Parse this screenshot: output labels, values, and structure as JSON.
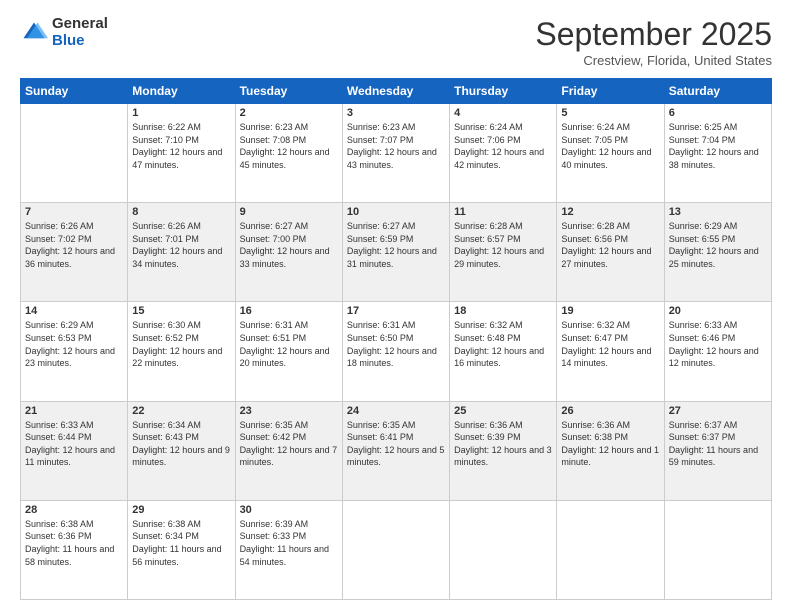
{
  "logo": {
    "general": "General",
    "blue": "Blue"
  },
  "header": {
    "month": "September 2025",
    "location": "Crestview, Florida, United States"
  },
  "weekdays": [
    "Sunday",
    "Monday",
    "Tuesday",
    "Wednesday",
    "Thursday",
    "Friday",
    "Saturday"
  ],
  "weeks": [
    [
      {
        "date": "",
        "sunrise": "",
        "sunset": "",
        "daylight": ""
      },
      {
        "date": "1",
        "sunrise": "Sunrise: 6:22 AM",
        "sunset": "Sunset: 7:10 PM",
        "daylight": "Daylight: 12 hours and 47 minutes."
      },
      {
        "date": "2",
        "sunrise": "Sunrise: 6:23 AM",
        "sunset": "Sunset: 7:08 PM",
        "daylight": "Daylight: 12 hours and 45 minutes."
      },
      {
        "date": "3",
        "sunrise": "Sunrise: 6:23 AM",
        "sunset": "Sunset: 7:07 PM",
        "daylight": "Daylight: 12 hours and 43 minutes."
      },
      {
        "date": "4",
        "sunrise": "Sunrise: 6:24 AM",
        "sunset": "Sunset: 7:06 PM",
        "daylight": "Daylight: 12 hours and 42 minutes."
      },
      {
        "date": "5",
        "sunrise": "Sunrise: 6:24 AM",
        "sunset": "Sunset: 7:05 PM",
        "daylight": "Daylight: 12 hours and 40 minutes."
      },
      {
        "date": "6",
        "sunrise": "Sunrise: 6:25 AM",
        "sunset": "Sunset: 7:04 PM",
        "daylight": "Daylight: 12 hours and 38 minutes."
      }
    ],
    [
      {
        "date": "7",
        "sunrise": "Sunrise: 6:26 AM",
        "sunset": "Sunset: 7:02 PM",
        "daylight": "Daylight: 12 hours and 36 minutes."
      },
      {
        "date": "8",
        "sunrise": "Sunrise: 6:26 AM",
        "sunset": "Sunset: 7:01 PM",
        "daylight": "Daylight: 12 hours and 34 minutes."
      },
      {
        "date": "9",
        "sunrise": "Sunrise: 6:27 AM",
        "sunset": "Sunset: 7:00 PM",
        "daylight": "Daylight: 12 hours and 33 minutes."
      },
      {
        "date": "10",
        "sunrise": "Sunrise: 6:27 AM",
        "sunset": "Sunset: 6:59 PM",
        "daylight": "Daylight: 12 hours and 31 minutes."
      },
      {
        "date": "11",
        "sunrise": "Sunrise: 6:28 AM",
        "sunset": "Sunset: 6:57 PM",
        "daylight": "Daylight: 12 hours and 29 minutes."
      },
      {
        "date": "12",
        "sunrise": "Sunrise: 6:28 AM",
        "sunset": "Sunset: 6:56 PM",
        "daylight": "Daylight: 12 hours and 27 minutes."
      },
      {
        "date": "13",
        "sunrise": "Sunrise: 6:29 AM",
        "sunset": "Sunset: 6:55 PM",
        "daylight": "Daylight: 12 hours and 25 minutes."
      }
    ],
    [
      {
        "date": "14",
        "sunrise": "Sunrise: 6:29 AM",
        "sunset": "Sunset: 6:53 PM",
        "daylight": "Daylight: 12 hours and 23 minutes."
      },
      {
        "date": "15",
        "sunrise": "Sunrise: 6:30 AM",
        "sunset": "Sunset: 6:52 PM",
        "daylight": "Daylight: 12 hours and 22 minutes."
      },
      {
        "date": "16",
        "sunrise": "Sunrise: 6:31 AM",
        "sunset": "Sunset: 6:51 PM",
        "daylight": "Daylight: 12 hours and 20 minutes."
      },
      {
        "date": "17",
        "sunrise": "Sunrise: 6:31 AM",
        "sunset": "Sunset: 6:50 PM",
        "daylight": "Daylight: 12 hours and 18 minutes."
      },
      {
        "date": "18",
        "sunrise": "Sunrise: 6:32 AM",
        "sunset": "Sunset: 6:48 PM",
        "daylight": "Daylight: 12 hours and 16 minutes."
      },
      {
        "date": "19",
        "sunrise": "Sunrise: 6:32 AM",
        "sunset": "Sunset: 6:47 PM",
        "daylight": "Daylight: 12 hours and 14 minutes."
      },
      {
        "date": "20",
        "sunrise": "Sunrise: 6:33 AM",
        "sunset": "Sunset: 6:46 PM",
        "daylight": "Daylight: 12 hours and 12 minutes."
      }
    ],
    [
      {
        "date": "21",
        "sunrise": "Sunrise: 6:33 AM",
        "sunset": "Sunset: 6:44 PM",
        "daylight": "Daylight: 12 hours and 11 minutes."
      },
      {
        "date": "22",
        "sunrise": "Sunrise: 6:34 AM",
        "sunset": "Sunset: 6:43 PM",
        "daylight": "Daylight: 12 hours and 9 minutes."
      },
      {
        "date": "23",
        "sunrise": "Sunrise: 6:35 AM",
        "sunset": "Sunset: 6:42 PM",
        "daylight": "Daylight: 12 hours and 7 minutes."
      },
      {
        "date": "24",
        "sunrise": "Sunrise: 6:35 AM",
        "sunset": "Sunset: 6:41 PM",
        "daylight": "Daylight: 12 hours and 5 minutes."
      },
      {
        "date": "25",
        "sunrise": "Sunrise: 6:36 AM",
        "sunset": "Sunset: 6:39 PM",
        "daylight": "Daylight: 12 hours and 3 minutes."
      },
      {
        "date": "26",
        "sunrise": "Sunrise: 6:36 AM",
        "sunset": "Sunset: 6:38 PM",
        "daylight": "Daylight: 12 hours and 1 minute."
      },
      {
        "date": "27",
        "sunrise": "Sunrise: 6:37 AM",
        "sunset": "Sunset: 6:37 PM",
        "daylight": "Daylight: 11 hours and 59 minutes."
      }
    ],
    [
      {
        "date": "28",
        "sunrise": "Sunrise: 6:38 AM",
        "sunset": "Sunset: 6:36 PM",
        "daylight": "Daylight: 11 hours and 58 minutes."
      },
      {
        "date": "29",
        "sunrise": "Sunrise: 6:38 AM",
        "sunset": "Sunset: 6:34 PM",
        "daylight": "Daylight: 11 hours and 56 minutes."
      },
      {
        "date": "30",
        "sunrise": "Sunrise: 6:39 AM",
        "sunset": "Sunset: 6:33 PM",
        "daylight": "Daylight: 11 hours and 54 minutes."
      },
      {
        "date": "",
        "sunrise": "",
        "sunset": "",
        "daylight": ""
      },
      {
        "date": "",
        "sunrise": "",
        "sunset": "",
        "daylight": ""
      },
      {
        "date": "",
        "sunrise": "",
        "sunset": "",
        "daylight": ""
      },
      {
        "date": "",
        "sunrise": "",
        "sunset": "",
        "daylight": ""
      }
    ]
  ]
}
